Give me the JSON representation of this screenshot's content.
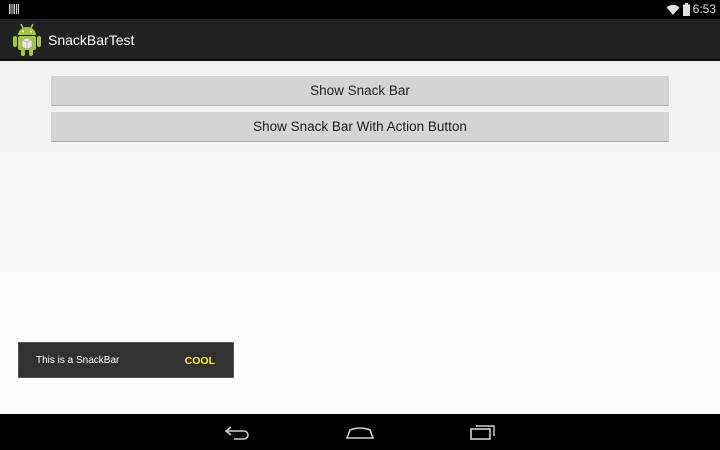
{
  "status_bar": {
    "time": "6:53",
    "icons": [
      "barcode-icon",
      "wifi-icon",
      "battery-icon"
    ]
  },
  "action_bar": {
    "title": "SnackBarTest",
    "icon": "android-app-icon",
    "background": "#222222"
  },
  "buttons": {
    "show_snack_bar": "Show Snack Bar",
    "show_snack_bar_action": "Show Snack Bar With Action Button"
  },
  "snackbar": {
    "message": "This is a SnackBar",
    "action_label": "COOL",
    "action_color": "#f3f321",
    "background": "#323232"
  },
  "nav_bar": {
    "icons": [
      "back-icon",
      "home-icon",
      "recent-apps-icon"
    ]
  }
}
